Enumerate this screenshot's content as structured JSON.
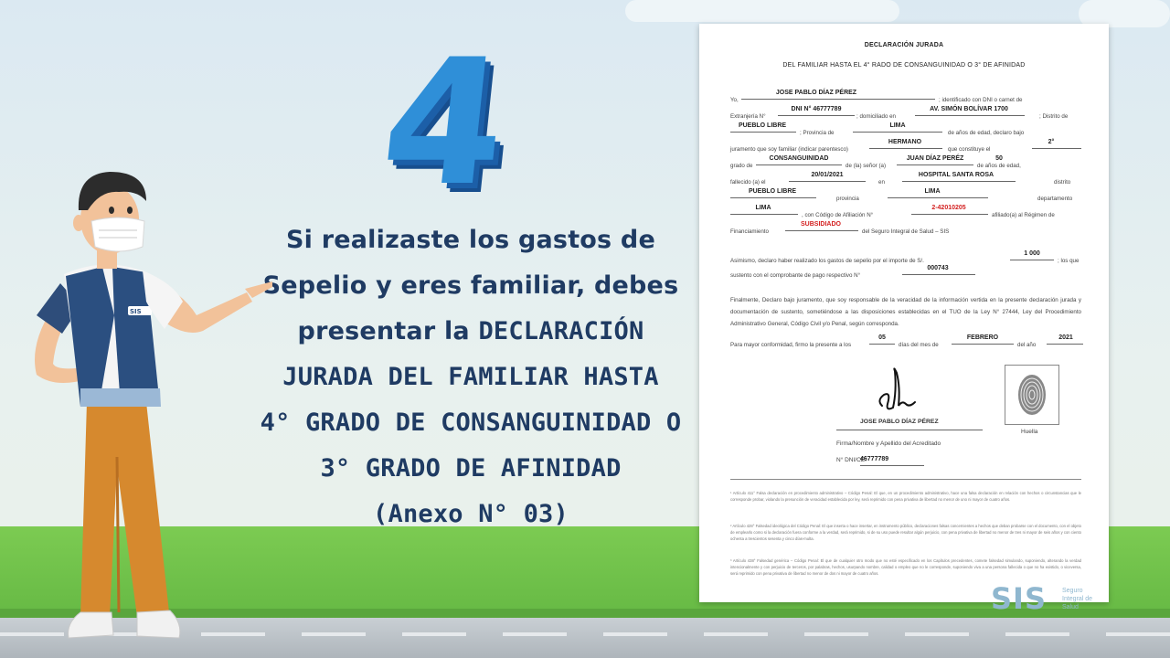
{
  "slide": {
    "number": "4",
    "message": {
      "line1": "Si realizaste los gastos de",
      "line2": "Sepelio y eres familiar, debes",
      "line3a": "presentar la ",
      "line3b": "DECLARACIÓN",
      "line4": "JURADA DEL FAMILIAR HASTA",
      "line5": "4° GRADO DE CONSANGUINIDAD O",
      "line6": "3° GRADO DE AFINIDAD",
      "line7": "(Anexo N° 03)"
    }
  },
  "document": {
    "title": "DECLARACIÓN JURADA",
    "subtitle": "DEL FAMILIAR HASTA EL 4° RADO DE CONSANGUINIDAD O 3° DE AFINIDAD",
    "lines": {
      "l1_pre": "Yo,",
      "l1_post": "; identificado con DNI o carnet de",
      "l2_pre": "Extranjería N°",
      "l2_mid": "; domiciliado en",
      "l2_post": "; Distrito de",
      "l3_mid": "; Provincia de",
      "l3_post": "de      años de edad, declaro bajo",
      "l4_pre": "juramento que soy familiar (indicar parentesco)",
      "l4_post": "que constituye el",
      "l5_pre": "grado de",
      "l5_mid": "de (la) señor (a)",
      "l5_post": "de      años de edad,",
      "l6_pre": "fallecido (a) el",
      "l6_mid": "en",
      "l6_post": "distrito",
      "l7_mid": "provincia",
      "l7_post": "departamento",
      "l8_mid": ", con Código de Afiliación N°",
      "l8_post": "afiliado(a) al Régimen de",
      "l9_pre": "Financiamiento",
      "l9_post": "del Seguro Integral de Salud – SIS"
    },
    "fields": {
      "name": "JOSE PABLO DÍAZ PÉREZ",
      "dni": "DNI N° 46777789",
      "address": "AV. SIMÓN BOLÍVAR 1700",
      "district": "PUEBLO LIBRE",
      "province": "LIMA",
      "relationship": "HERMANO",
      "degree": "2°",
      "kinship": "CONSANGUINIDAD",
      "deceased": "JUAN DÍAZ PERÉZ",
      "age": "50",
      "date": "20/01/2021",
      "place": "HOSPITAL SANTA ROSA",
      "district2": "PUEBLO LIBRE",
      "province2": "LIMA",
      "department": "LIMA",
      "affiliation_code": "2-42010205",
      "regime": "SUBSIDIADO",
      "amount": "1 000",
      "receipt": "000743",
      "day": "05",
      "month": "FEBRERO",
      "year": "2021"
    },
    "para_expenses_pre": "Asimismo, declaro haber realizado los gastos de sepelio por el importe de S/.",
    "para_expenses_post": "; los que",
    "para_expenses_line2": "sustento con el comprobante de pago respectivo N°",
    "para_final": "Finalmente, Declaro bajo juramento, que soy responsable de la veracidad de la información vertida en la presente declaración jurada y documentación de sustento, sometiéndose a las disposiciones establecidas en el TUO de la Ley N° 27444, Ley del Procedimiento Administrativo General, Código Civil y/o Penal, según corresponda.",
    "conformity_pre": "Para mayor conformidad, firmo la presente a los",
    "conformity_mid1": "días del mes de",
    "conformity_mid2": "del año",
    "signer_name": "JOSE PABLO DÍAZ PÉREZ",
    "signer_label": "Firma/Nombre y Apellido del Acreditado",
    "signer_dni_label": "N° DNI/CE:",
    "signer_dni": "46777789",
    "fingerprint_label": "Huella",
    "footnote1": "¹ Artículo 411° Falsa declaración en procedimiento administrativo – Código Penal: El que, en un procedimiento administrativo, hace una falsa declaración en relación con hechos o circunstancias que le corresponde probar, violando la presunción de veracidad establecida por ley, será reprimido con pena privativa de libertad no menor de uno ni mayor de cuatro años.",
    "footnote2": "² Artículo 428° Falsedad ideológica del Código Penal: El que inserta o hace insertar, en instrumento público, declaraciones falsas concernientes a hechos que deban probarse con el documento, con el objeto de emplearlo como si la declaración fuera conforme a la verdad, será reprimido, si de su uso puede resultar algún perjuicio, con pena privativa de libertad no menor de tres ni mayor de seis años y con ciento ochenta a trescientos sesenta y cinco días-multa.",
    "footnote3": "³ Artículo 438° Falsedad genérica – Código Penal: El que de cualquier otro modo que no esté especificado en los Capítulos precedentes, comete falsedad simulando, suponiendo, alterando la verdad intencionalmente y con perjuicio de terceros, por palabras, hechos, usurpando nombre, calidad o empleo que no le corresponde, suponiendo viva a una persona fallecida o que no ha existido, o viceversa, será reprimido con pena privativa de libertad no menor de dos ni mayor de cuatro años."
  },
  "logo": {
    "text": "SIS",
    "sub": "Seguro Integral de Salud"
  },
  "person": {
    "badge": "SIS"
  }
}
